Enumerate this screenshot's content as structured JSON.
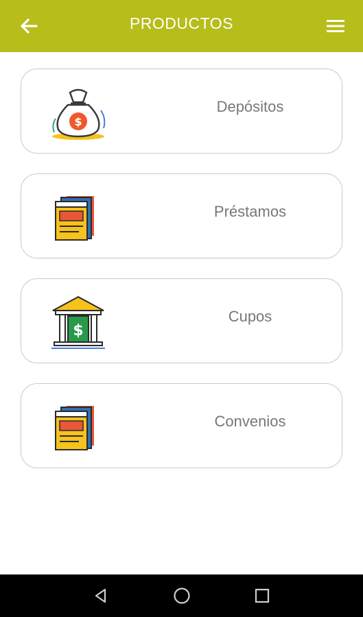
{
  "header": {
    "title": "PRODUCTOS",
    "back_icon": "arrow-left-icon",
    "menu_icon": "hamburger-menu-icon",
    "background_color": "#b7bd1a"
  },
  "products": [
    {
      "label": "Depósitos",
      "icon": "money-bag-icon"
    },
    {
      "label": "Préstamos",
      "icon": "document-book-icon"
    },
    {
      "label": "Cupos",
      "icon": "bank-dollar-icon"
    },
    {
      "label": "Convenios",
      "icon": "document-book-icon"
    }
  ],
  "system_nav": {
    "back_icon": "triangle-back-icon",
    "home_icon": "circle-home-icon",
    "recents_icon": "square-recents-icon"
  }
}
